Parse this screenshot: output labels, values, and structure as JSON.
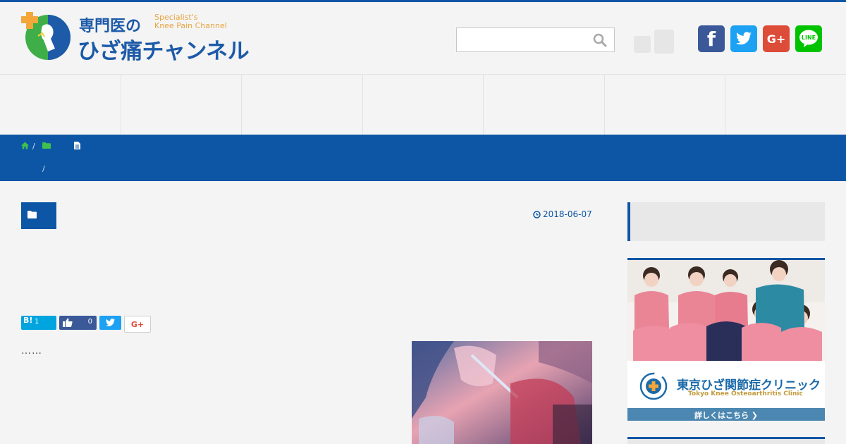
{
  "site": {
    "logo_title1": "専門医の",
    "logo_title2": "ひざ痛チャンネル",
    "logo_sub1": "Specialist's",
    "logo_sub2": "Knee Pain Channel"
  },
  "search": {
    "placeholder": "",
    "value": ""
  },
  "social": {
    "facebook_label": "f",
    "googleplus_label": "G+"
  },
  "nav": {
    "items": [
      "",
      "",
      "",
      "",
      "",
      "",
      ""
    ]
  },
  "breadcrumb": {
    "sep1": "/",
    "sep2": "/"
  },
  "post": {
    "date": "2018-06-07",
    "excerpt": "……",
    "share": {
      "hatena_label": "B!",
      "hatena_count": "1",
      "like_count": "0",
      "gplus_label": "G+"
    }
  },
  "sidebar": {
    "ad_title": "東京ひざ関節症クリニック",
    "ad_subtitle": "Tokyo Knee Osteoarthritis Clinic",
    "ad_cta": "詳しくはこちら ❯"
  },
  "colors": {
    "brand_blue": "#0d56a6",
    "facebook": "#3b5998",
    "twitter": "#1da1f2",
    "googleplus": "#dd4b39",
    "line": "#00c300",
    "hatena": "#00a4de"
  }
}
